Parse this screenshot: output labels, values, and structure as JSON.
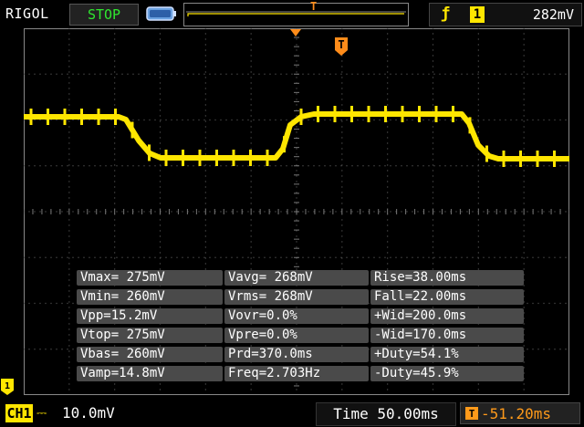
{
  "topbar": {
    "brand": "RIGOL",
    "run_status": "STOP",
    "trigger_marker": "T"
  },
  "trigger": {
    "edge_symbol": "ƒ",
    "source": "1",
    "level": "282mV"
  },
  "waveform_marker": "T",
  "measurements": {
    "rows": [
      [
        "Vmax= 275mV",
        "Vavg= 268mV",
        "Rise=38.00ms"
      ],
      [
        "Vmin= 260mV",
        "Vrms= 268mV",
        "Fall=22.00ms"
      ],
      [
        "Vpp=15.2mV",
        "Vovr=0.0%",
        "+Wid=200.0ms"
      ],
      [
        "Vtop= 275mV",
        "Vpre=0.0%",
        "-Wid=170.0ms"
      ],
      [
        "Vbas= 260mV",
        "Prd=370.0ms",
        "+Duty=54.1%"
      ],
      [
        "Vamp=14.8mV",
        "Freq=2.703Hz",
        "-Duty=45.9%"
      ]
    ]
  },
  "channel": {
    "label": "CH1",
    "coupling_symbol": "⎓",
    "scale": "10.0mV"
  },
  "timebase": {
    "text": "Time 50.00ms"
  },
  "offset": {
    "text": "-51.20ms"
  },
  "colors": {
    "trace": "#ffe600",
    "grid": "#4a4a4a",
    "status": "#2fe82f",
    "offset": "#ff9a1a",
    "orange_marker": "#ff8c1a"
  }
}
